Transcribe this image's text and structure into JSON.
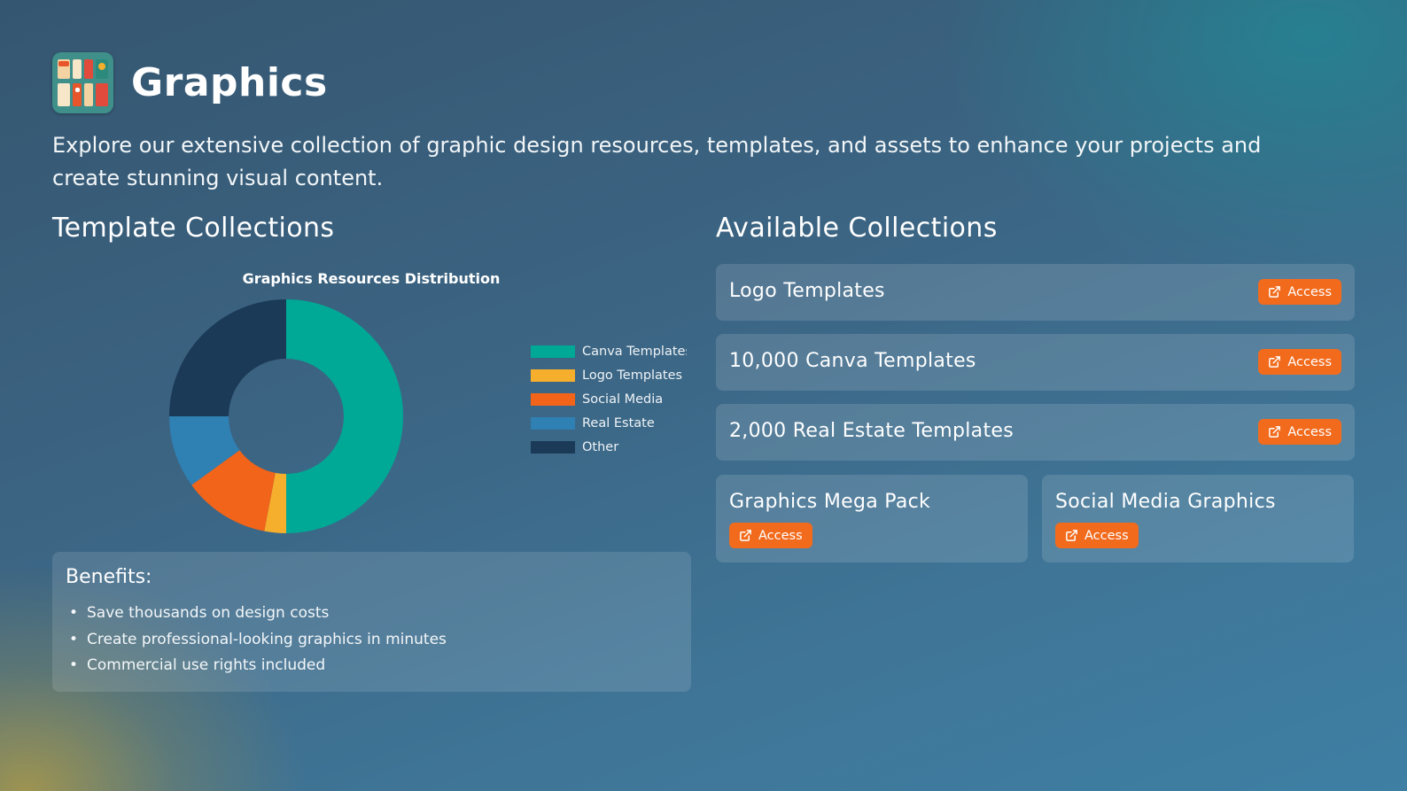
{
  "header": {
    "title": "Graphics"
  },
  "intro": "Explore our extensive collection of graphic design resources, templates, and assets to enhance your projects and create stunning visual content.",
  "left_section": {
    "title": "Template Collections"
  },
  "right_section": {
    "title": "Available Collections"
  },
  "chart_data": {
    "type": "pie",
    "title": "Graphics Resources Distribution",
    "donut": true,
    "legend_position": "right",
    "categories": [
      "Canva Templates",
      "Logo Templates",
      "Social Media",
      "Real Estate",
      "Other"
    ],
    "values": [
      50,
      3,
      12,
      10,
      25
    ],
    "colors": [
      "#00a896",
      "#f6ae2d",
      "#f26419",
      "#2f80b3",
      "#1b3a57"
    ]
  },
  "benefits": {
    "title": "Benefits:",
    "items": [
      "Save thousands on design costs",
      "Create professional-looking graphics in minutes",
      "Commercial use rights included"
    ]
  },
  "collections": [
    {
      "title": "Logo Templates",
      "button": "Access"
    },
    {
      "title": "10,000 Canva Templates",
      "button": "Access"
    },
    {
      "title": "2,000 Real Estate Templates",
      "button": "Access"
    },
    {
      "title": "Graphics Mega Pack",
      "button": "Access"
    },
    {
      "title": "Social Media Graphics",
      "button": "Access"
    }
  ],
  "colors": {
    "accent": "#f26b1d"
  },
  "icons": {
    "button_icon": "external-link-icon",
    "logo": "graphics-app-icon"
  }
}
